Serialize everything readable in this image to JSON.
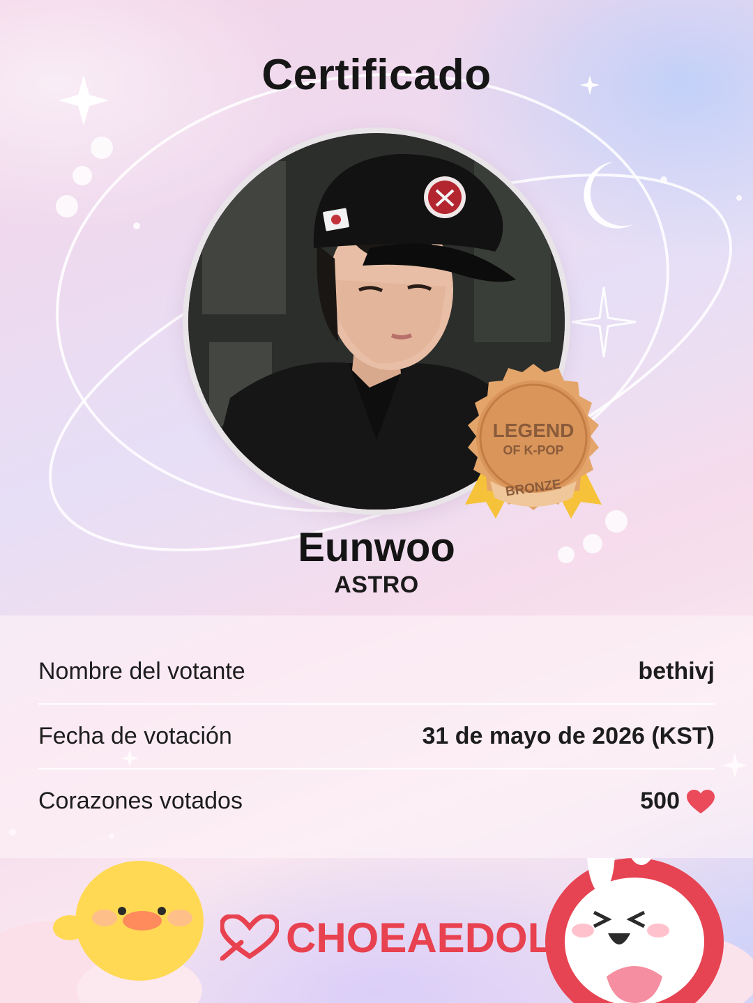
{
  "certificate": {
    "title": "Certificado",
    "idol_name": "Eunwoo",
    "group": "ASTRO"
  },
  "badge": {
    "line1": "LEGEND",
    "line2": "OF K-POP",
    "tier": "BRONZE"
  },
  "details": [
    {
      "label": "Nombre del votante",
      "value": "bethivj"
    },
    {
      "label": "Fecha de votación",
      "value": "31 de mayo de 2026 (KST)"
    },
    {
      "label": "Corazones votados",
      "value": "500"
    }
  ],
  "brand": {
    "name": "CHOEAEDOL",
    "color": "#e8414f"
  },
  "colors": {
    "heart": "#ea4a5a",
    "badge_bronze": "#d9955a"
  }
}
